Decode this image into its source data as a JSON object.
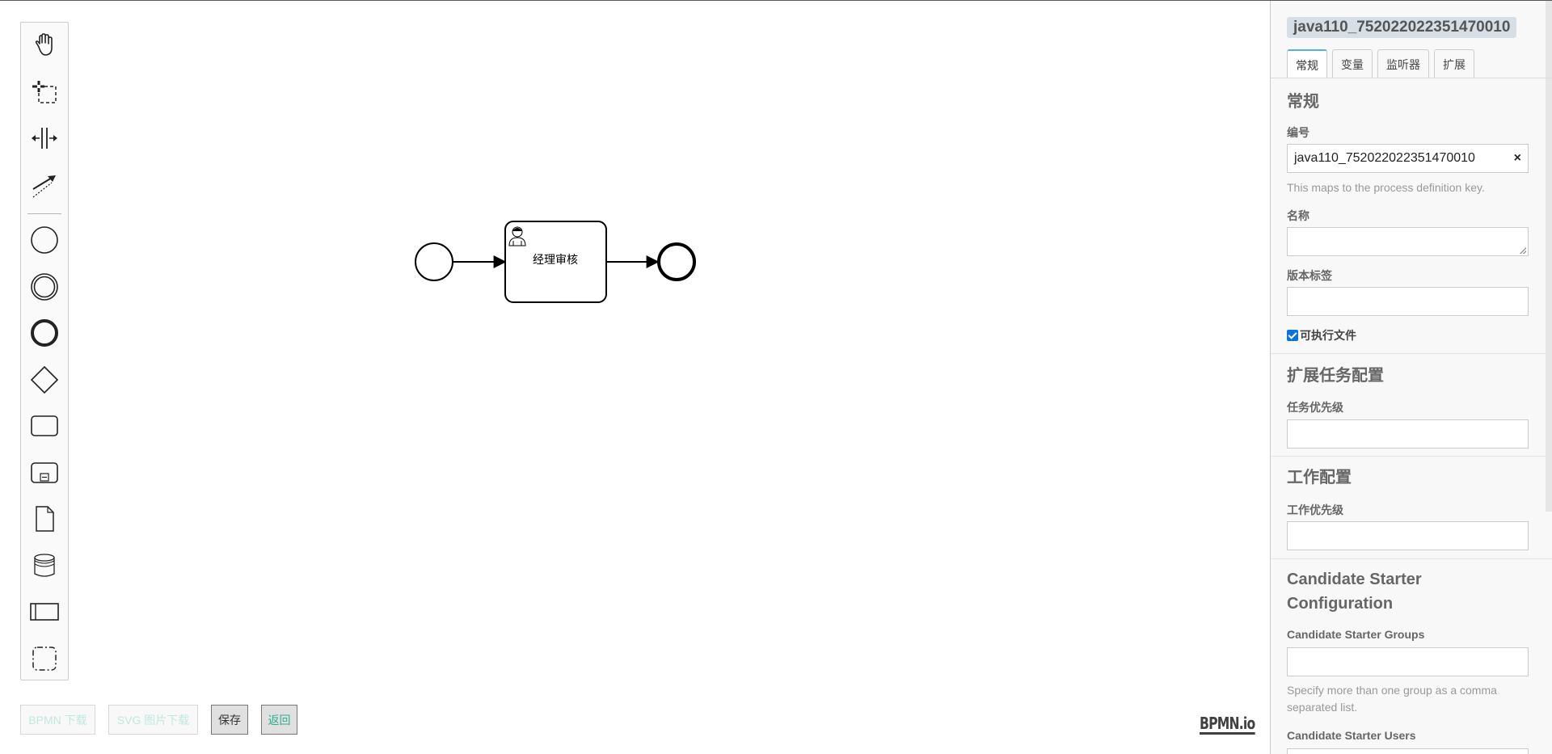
{
  "palette": {
    "tools": [
      {
        "name": "hand-tool",
        "icon": "hand-icon"
      },
      {
        "name": "lasso-tool",
        "icon": "lasso-icon"
      },
      {
        "name": "space-tool",
        "icon": "space-icon"
      },
      {
        "name": "global-connect-tool",
        "icon": "connect-icon"
      },
      {
        "name": "start-event",
        "icon": "start-event-icon"
      },
      {
        "name": "intermediate-event",
        "icon": "intermediate-event-icon"
      },
      {
        "name": "end-event",
        "icon": "end-event-icon"
      },
      {
        "name": "exclusive-gateway",
        "icon": "gateway-icon"
      },
      {
        "name": "task",
        "icon": "task-icon"
      },
      {
        "name": "subprocess",
        "icon": "subprocess-icon"
      },
      {
        "name": "data-object",
        "icon": "data-object-icon"
      },
      {
        "name": "data-store",
        "icon": "data-store-icon"
      },
      {
        "name": "participant",
        "icon": "participant-icon"
      },
      {
        "name": "group",
        "icon": "group-icon"
      }
    ]
  },
  "diagram": {
    "task_label": "经理审核"
  },
  "buttons": {
    "bpmn_download": "BPMN 下载",
    "svg_download": "SVG 图片下载",
    "save": "保存",
    "back": "返回"
  },
  "logo": "BPMN.io",
  "panel": {
    "header_title": "java110_752022022351470010",
    "tabs": [
      "常规",
      "变量",
      "监听器",
      "扩展"
    ],
    "general": {
      "title": "常规",
      "id_label": "编号",
      "id_value": "java110_752022022351470010",
      "id_hint": "This maps to the process definition key.",
      "name_label": "名称",
      "name_value": "",
      "version_label": "版本标签",
      "version_value": "",
      "executable_label": "可执行文件",
      "executable_checked": true
    },
    "ext_task": {
      "title": "扩展任务配置",
      "priority_label": "任务优先级"
    },
    "job": {
      "title": "工作配置",
      "priority_label": "工作优先级"
    },
    "candidate": {
      "title": "Candidate Starter Configuration",
      "groups_label": "Candidate Starter Groups",
      "groups_hint": "Specify more than one group as a comma separated list.",
      "users_label": "Candidate Starter Users"
    }
  }
}
